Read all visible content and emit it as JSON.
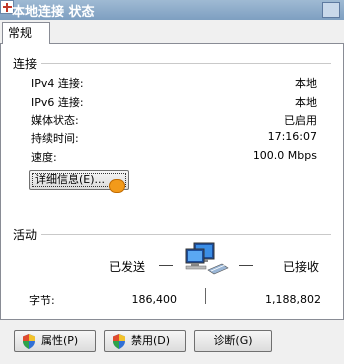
{
  "window": {
    "title": "本地连接 状态"
  },
  "tabs": [
    {
      "label": "常规"
    }
  ],
  "connection": {
    "group_title": "连接",
    "rows": [
      {
        "label": "IPv4 连接:",
        "value": "本地"
      },
      {
        "label": "IPv6 连接:",
        "value": "本地"
      },
      {
        "label": "媒体状态:",
        "value": "已启用"
      },
      {
        "label": "持续时间:",
        "value": "17:16:07"
      },
      {
        "label": "速度:",
        "value": "100.0 Mbps"
      }
    ],
    "details_button": "详细信息(E)..."
  },
  "activity": {
    "group_title": "活动",
    "sent_label": "已发送",
    "received_label": "已接收",
    "bytes_label": "字节:",
    "bytes_sent": "186,400",
    "bytes_received": "1,188,802"
  },
  "buttons": {
    "properties": "属性(P)",
    "disable": "禁用(D)",
    "diagnose": "诊断(G)"
  },
  "colors": {
    "accent": "#7e9fc1",
    "balloon": "#f29a1a"
  },
  "icons": {
    "network": "network-computers-icon",
    "shield": "uac-shield-icon",
    "window": "network-connection-icon"
  }
}
